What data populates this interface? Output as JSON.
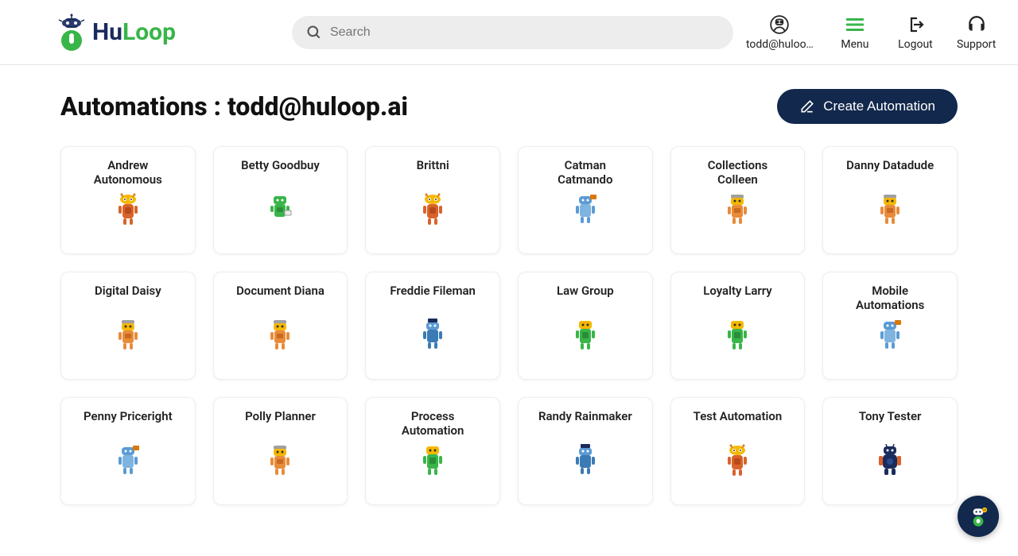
{
  "brand": {
    "hu": "Hu",
    "loop": "Loop"
  },
  "search": {
    "placeholder": "Search"
  },
  "header": {
    "user": "todd@huloo…",
    "menu": "Menu",
    "logout": "Logout",
    "support": "Support"
  },
  "page": {
    "title": "Automations : todd@huloop.ai",
    "create_label": "Create Automation"
  },
  "cards": [
    {
      "name": "Andrew\nAutonomous",
      "robot": "orange"
    },
    {
      "name": "Betty Goodbuy",
      "robot": "green"
    },
    {
      "name": "Brittni",
      "robot": "orange"
    },
    {
      "name": "Catman\nCatmando",
      "robot": "blue"
    },
    {
      "name": "Collections\nColleen",
      "robot": "orange2"
    },
    {
      "name": "Danny Datadude",
      "robot": "orange2"
    },
    {
      "name": "Digital Daisy",
      "robot": "orange2"
    },
    {
      "name": "Document Diana",
      "robot": "orange2"
    },
    {
      "name": "Freddie Fileman",
      "robot": "blue2"
    },
    {
      "name": "Law Group",
      "robot": "green2"
    },
    {
      "name": "Loyalty Larry",
      "robot": "green2"
    },
    {
      "name": "Mobile\nAutomations",
      "robot": "blue"
    },
    {
      "name": "Penny Priceright",
      "robot": "blue"
    },
    {
      "name": "Polly Planner",
      "robot": "orange2"
    },
    {
      "name": "Process\nAutomation",
      "robot": "green2"
    },
    {
      "name": "Randy Rainmaker",
      "robot": "blue2"
    },
    {
      "name": "Test Automation",
      "robot": "orange"
    },
    {
      "name": "Tony Tester",
      "robot": "navy"
    }
  ]
}
